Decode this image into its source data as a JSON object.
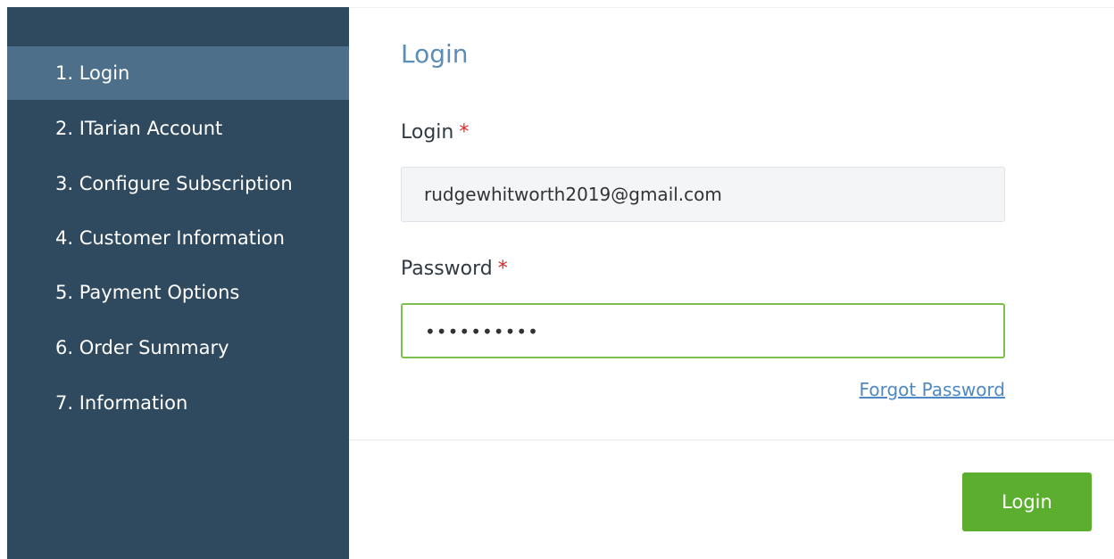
{
  "sidebar": {
    "items": [
      {
        "label": "1. Login",
        "active": true
      },
      {
        "label": "2. ITarian Account"
      },
      {
        "label": "3. Configure Subscription"
      },
      {
        "label": "4. Customer Information"
      },
      {
        "label": "5. Payment Options"
      },
      {
        "label": "6. Order Summary"
      },
      {
        "label": "7. Information"
      }
    ]
  },
  "form": {
    "title": "Login",
    "login_label": "Login",
    "login_required": "*",
    "login_value": "rudgewhitworth2019@gmail.com",
    "password_label": "Password",
    "password_required": "*",
    "password_value": "••••••••••",
    "forgot_link": "Forgot Password",
    "submit_label": "Login"
  },
  "colors": {
    "sidebar_bg": "#2f4a5f",
    "sidebar_active": "#4e6f89",
    "title": "#5b8db6",
    "required": "#e02424",
    "focus_border": "#7cc04b",
    "button": "#5cae2f",
    "link": "#4d8ac3"
  }
}
